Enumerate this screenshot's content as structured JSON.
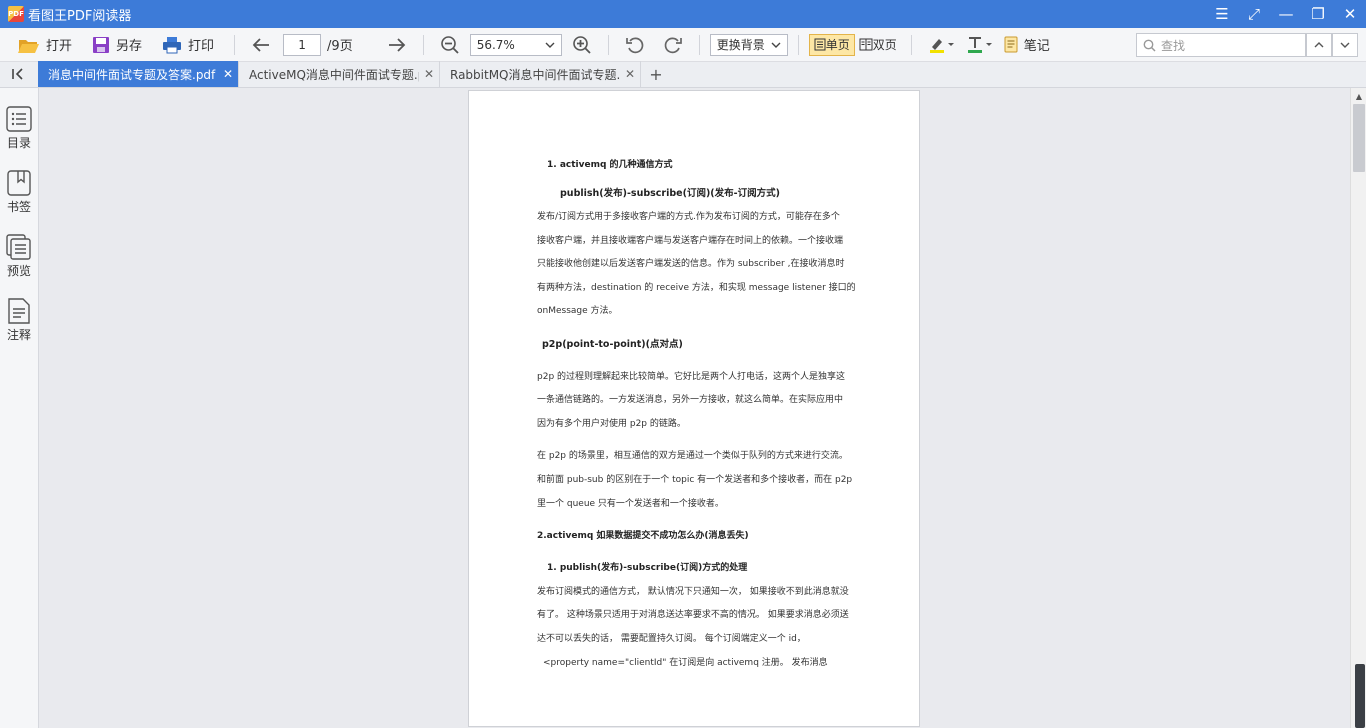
{
  "app": {
    "title": "看图王PDF阅读器",
    "logo_text": "PDF"
  },
  "window_controls": {
    "menu": "☰",
    "fullscreen": "⤢",
    "minimize": "—",
    "restore": "❐",
    "close": "✕"
  },
  "toolbar": {
    "open": "打开",
    "save_as": "另存",
    "print": "打印",
    "page_current": "1",
    "page_total": "/9页",
    "zoom": "56.7%",
    "background": "更换背景",
    "single_page": "单页",
    "double_page": "双页",
    "notes": "笔记",
    "search_placeholder": "查找"
  },
  "tabs": [
    {
      "label": "消息中间件面试专题及答案.pdf",
      "active": true
    },
    {
      "label": "ActiveMQ消息中间件面试专题.pdf",
      "active": false
    },
    {
      "label": "RabbitMQ消息中间件面试专题.pdf",
      "active": false
    }
  ],
  "sidebar": [
    {
      "label": "目录",
      "icon": "toc-icon"
    },
    {
      "label": "书签",
      "icon": "bookmark-icon"
    },
    {
      "label": "预览",
      "icon": "thumbnail-icon"
    },
    {
      "label": "注释",
      "icon": "annotation-icon"
    }
  ],
  "document": {
    "lines": [
      "1.   activemq 的几种通信方式",
      "publish(发布)-subscribe(订阅)(发布-订阅方式)",
      "发布/订阅方式用于多接收客户端的方式.作为发布订阅的方式，可能存在多个",
      "接收客户端，并且接收端客户端与发送客户端存在时间上的依赖。一个接收端",
      "只能接收他创建以后发送客户端发送的信息。作为 subscriber ,在接收消息时",
      "有两种方法，destination 的 receive 方法，和实现 message listener 接口的",
      "onMessage 方法。",
      "p2p(point-to-point)(点对点)",
      "p2p 的过程则理解起来比较简单。它好比是两个人打电话，这两个人是独享这",
      "一条通信链路的。一方发送消息，另外一方接收，就这么简单。在实际应用中",
      "因为有多个用户对使用 p2p 的链路。",
      "在 p2p 的场景里，相互通信的双方是通过一个类似于队列的方式来进行交流。",
      "和前面 pub-sub 的区别在于一个 topic 有一个发送者和多个接收者，而在 p2p",
      "里一个 queue 只有一个发送者和一个接收者。",
      "2.activemq 如果数据提交不成功怎么办(消息丢失)",
      "1.   publish(发布)-subscribe(订阅)方式的处理",
      "发布订阅模式的通信方式， 默认情况下只通知一次， 如果接收不到此消息就没",
      "有了。 这种场景只适用于对消息送达率要求不高的情况。 如果要求消息必须送",
      "达不可以丢失的话， 需要配置持久订阅。 每个订阅端定义一个 id，",
      "<property name=\"clientId\" 在订阅是向 activemq 注册。 发布消息"
    ]
  }
}
